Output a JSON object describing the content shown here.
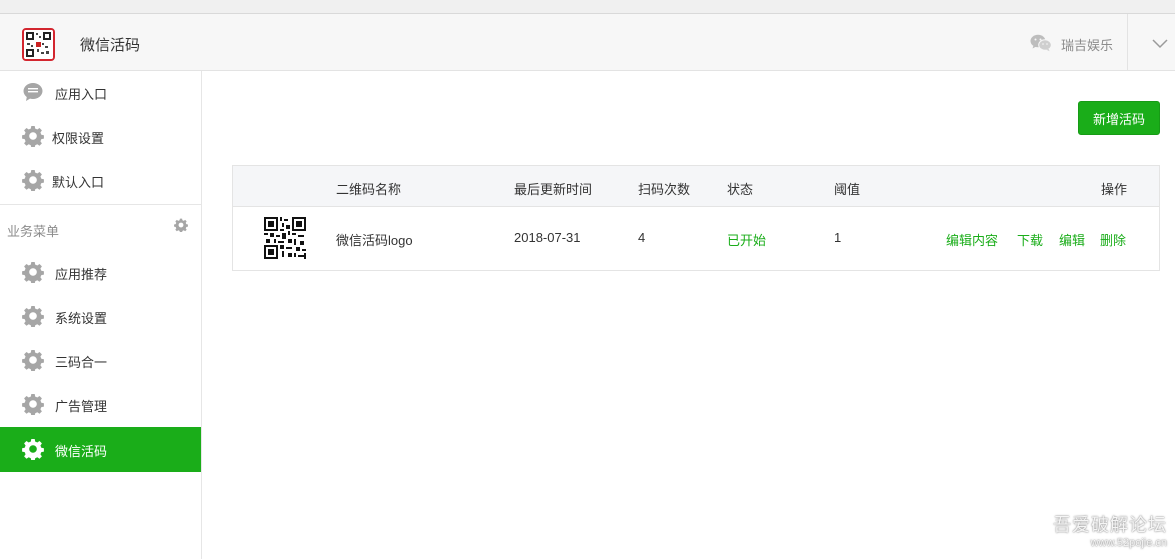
{
  "header": {
    "app_title": "微信活码",
    "account_name": "瑞吉娱乐"
  },
  "sidebar": {
    "top_items": [
      {
        "label": "应用入口",
        "icon": "chat-bubble-icon"
      },
      {
        "label": "权限设置",
        "icon": "gear-icon"
      },
      {
        "label": "默认入口",
        "icon": "gear-icon"
      }
    ],
    "section_title": "业务菜单",
    "section_items": [
      {
        "label": "应用推荐",
        "icon": "gear-icon"
      },
      {
        "label": "系统设置",
        "icon": "gear-icon"
      },
      {
        "label": "三码合一",
        "icon": "gear-icon"
      },
      {
        "label": "广告管理",
        "icon": "gear-icon"
      },
      {
        "label": "微信活码",
        "icon": "gear-icon",
        "active": true
      }
    ]
  },
  "toolbar": {
    "new_button_label": "新增活码"
  },
  "table": {
    "headers": {
      "name": "二维码名称",
      "updated": "最后更新时间",
      "scans": "扫码次数",
      "status": "状态",
      "threshold": "阈值",
      "actions": "操作"
    },
    "rows": [
      {
        "name": "微信活码logo",
        "updated": "2018-07-31",
        "scans": "4",
        "status": "已开始",
        "threshold": "1",
        "actions": {
          "edit_content": "编辑内容",
          "download": "下载",
          "edit": "编辑",
          "delete": "删除"
        }
      }
    ]
  },
  "watermark": {
    "line1": "吾爱破解论坛",
    "line2": "www.52pojie.cn"
  },
  "colors": {
    "accent": "#1aad19",
    "logo_border": "#d3262f"
  }
}
